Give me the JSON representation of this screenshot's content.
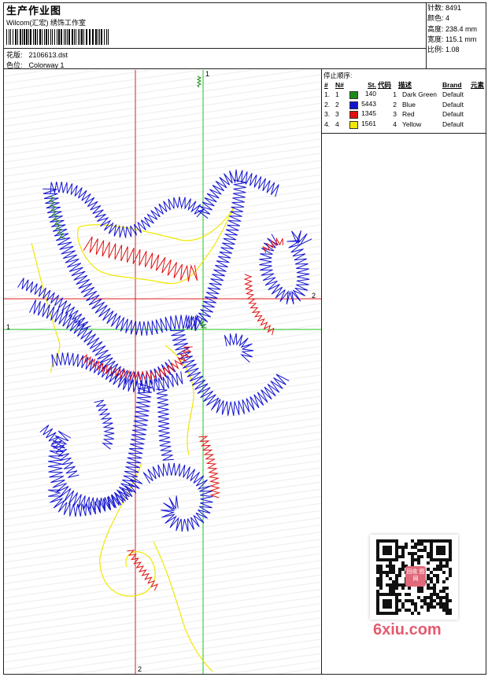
{
  "header": {
    "title": "生产作业图",
    "studio": "Wilcom(汇宏) 绣饰工作室",
    "file_label": "花版:",
    "file_value": "2106613.dst",
    "colorway_label": "色位:",
    "colorway_value": "Colorway 1"
  },
  "stats": {
    "stitches": "针数: 8491",
    "colors": "颜色: 4",
    "height": "高度: 238.4 mm",
    "width": "宽度: 115.1 mm",
    "ratio": "比例: 1.08"
  },
  "stop_sequence": {
    "title": "停止顺序:",
    "columns": [
      "#",
      "N#",
      "St.",
      "代码",
      "描述",
      "Brand",
      "元素"
    ],
    "rows": [
      {
        "index": "1.",
        "n": "1",
        "color": "#1a8c1a",
        "stitches": "140",
        "code": "1",
        "description": "Dark Green",
        "brand": "Default"
      },
      {
        "index": "2.",
        "n": "2",
        "color": "#1414d0",
        "stitches": "5443",
        "code": "2",
        "description": "Blue",
        "brand": "Default"
      },
      {
        "index": "3.",
        "n": "3",
        "color": "#e01010",
        "stitches": "1345",
        "code": "3",
        "description": "Red",
        "brand": "Default"
      },
      {
        "index": "4.",
        "n": "4",
        "color": "#f0e800",
        "stitches": "1561",
        "code": "4",
        "description": "Yellow",
        "brand": "Default"
      }
    ]
  },
  "axis_labels": {
    "v_green_top": "1",
    "h_green_left": "1",
    "h_red_right": "2",
    "v_red_bottom": "2"
  },
  "watermark": {
    "text": "6xiu.com",
    "badge": "回收 图网"
  }
}
